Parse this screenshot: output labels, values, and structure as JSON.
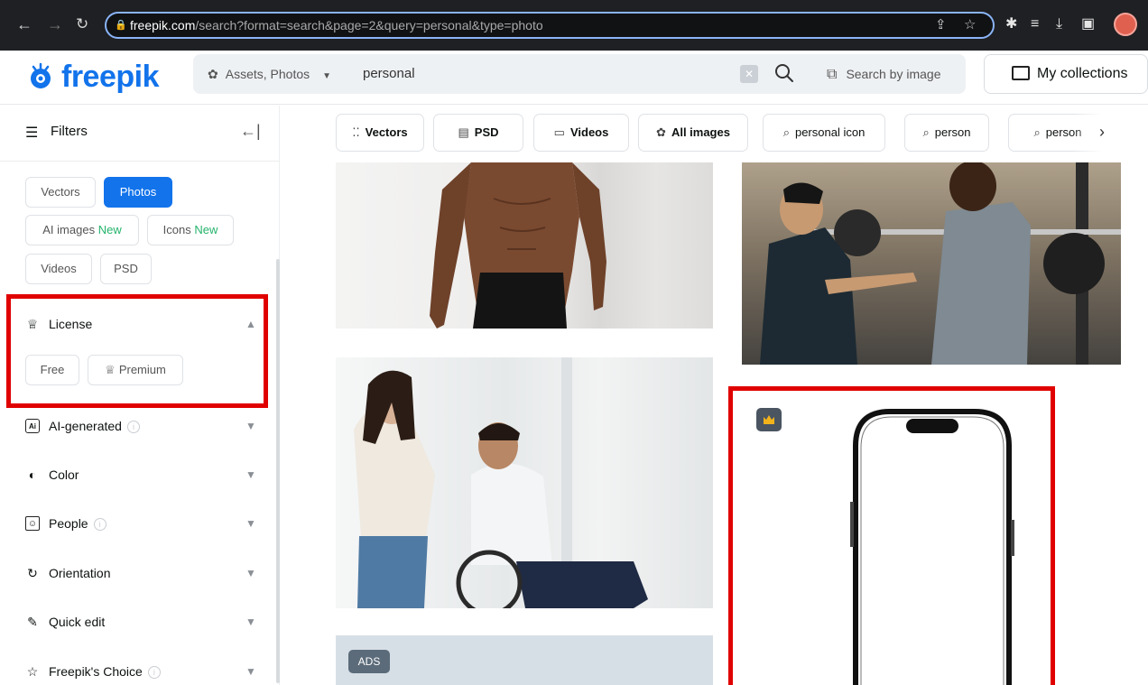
{
  "browser": {
    "url_domain": "freepik.com",
    "url_rest": "/search?format=search&page=2&query=personal&type=photo"
  },
  "header": {
    "logo": "freepik",
    "asset_type": "Assets, Photos",
    "search_value": "personal",
    "search_by_image": "Search by image",
    "my_collections": "My collections"
  },
  "sidebar": {
    "title": "Filters",
    "type_chips": [
      "Vectors",
      "Photos",
      "AI images",
      "Icons",
      "Videos",
      "PSD"
    ],
    "new_label": "New",
    "license": {
      "title": "License",
      "options": [
        "Free",
        "Premium"
      ]
    },
    "sections": [
      "AI-generated",
      "Color",
      "People",
      "Orientation",
      "Quick edit",
      "Freepik's Choice"
    ]
  },
  "tags": [
    "Vectors",
    "PSD",
    "Videos",
    "All images",
    "personal icon",
    "person",
    "person"
  ],
  "results": {
    "ads_label": "ADS"
  },
  "colors": {
    "brand": "#1273eb",
    "highlight": "#e00000",
    "new": "#24b36b"
  }
}
